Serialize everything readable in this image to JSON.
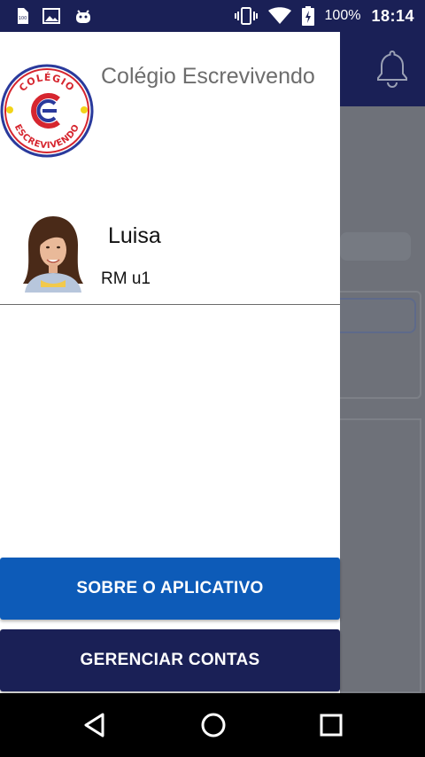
{
  "status_bar": {
    "battery_percent": "100%",
    "time": "18:14",
    "icons": [
      "sim-100-icon",
      "image-icon",
      "android-icon",
      "vibrate-icon",
      "wifi-icon",
      "battery-charging-icon"
    ]
  },
  "school": {
    "name": "Colégio Escrevivendo",
    "logo_text_top": "COLÉGIO",
    "logo_text_bottom": "ESCREVIVENDO",
    "logo_letter": "E"
  },
  "user": {
    "name": "Luisa",
    "rm": "RM u1"
  },
  "buttons": {
    "about": "SOBRE O APLICATIVO",
    "accounts": "GERENCIAR CONTAS"
  },
  "colors": {
    "primary_dark": "#1a2056",
    "primary_blue": "#0d5bb8",
    "logo_red": "#d6262f",
    "logo_blue": "#2a3a9c",
    "logo_yellow": "#f2d418"
  },
  "nav_bar": {
    "icons": [
      "back-icon",
      "home-icon",
      "recents-icon"
    ]
  }
}
